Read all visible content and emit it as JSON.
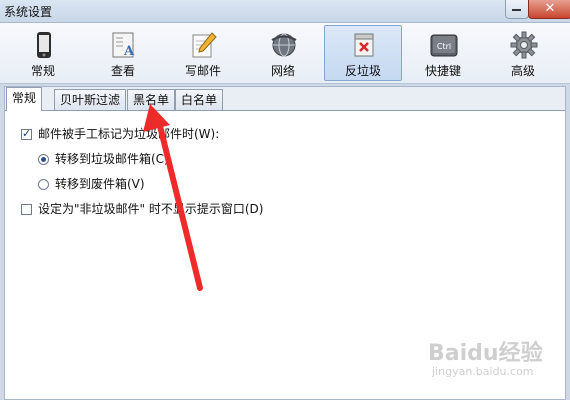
{
  "window": {
    "title": "系统设置",
    "close_glyph": "✕"
  },
  "toolbar": {
    "items": [
      {
        "label": "常规",
        "icon": "phone-icon"
      },
      {
        "label": "查看",
        "icon": "view-doc-icon"
      },
      {
        "label": "写邮件",
        "icon": "compose-pencil-icon"
      },
      {
        "label": "网络",
        "icon": "globe-icon"
      },
      {
        "label": "反垃圾",
        "icon": "antispam-icon",
        "active": true
      },
      {
        "label": "快捷键",
        "icon": "ctrl-key-icon",
        "key_text": "Ctrl"
      },
      {
        "label": "高级",
        "icon": "gear-icon"
      }
    ]
  },
  "tabs": [
    {
      "label": "常规",
      "selected": true
    },
    {
      "label": "贝叶斯过滤"
    },
    {
      "label": "黑名单"
    },
    {
      "label": "白名单"
    }
  ],
  "options": {
    "manual_mark": {
      "label": "邮件被手工标记为垃圾邮件时(W):",
      "checked": true
    },
    "move_junk": {
      "label": "转移到垃圾邮件箱(C)",
      "selected": true
    },
    "move_trash": {
      "label": "转移到废件箱(V)",
      "selected": false
    },
    "no_prompt": {
      "label": "设定为\"非垃圾邮件\" 时不显示提示窗口(D)",
      "checked": false
    }
  },
  "annotation": {
    "color": "#ee2b2b"
  },
  "watermark": {
    "brand": "Baidu经验",
    "url": "jingyan.baidu.com"
  }
}
